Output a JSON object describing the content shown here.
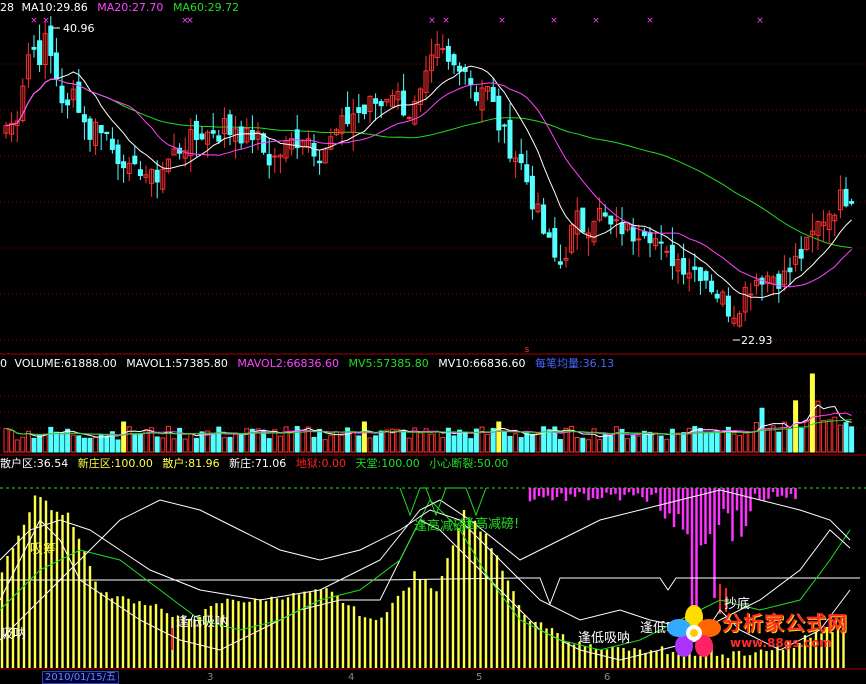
{
  "colors": {
    "bg": "#000000",
    "up": "#ff3030",
    "down": "#54ffff",
    "ma10": "#ffffff",
    "ma20": "#ff44ff",
    "ma60": "#22dd22",
    "yellow": "#ffff44",
    "grid": "#8b0000",
    "magenta": "#ff33ff"
  },
  "price_panel": {
    "left_cut": "28",
    "ma10_label": "MA10:29.86",
    "ma20_label": "MA20:27.70",
    "ma60_label": "MA60:29.72",
    "high_label": "40.96",
    "low_label": "22.93",
    "marker_glyph": "×",
    "s_glyph": "s"
  },
  "volume_panel": {
    "left_cut": "0",
    "volume": "VOLUME:61888.00",
    "mavol1": "MAVOL1:57385.80",
    "mavol2": "MAVOL2:66836.60",
    "mv5": "MV5:57385.80",
    "mv10": "MV10:66836.60",
    "avg_label": "每笔均量:36.13"
  },
  "indicator_panel": {
    "sanhu_label": "散户区:36.54",
    "xinzhuang_area": "新庄区:100.00",
    "sanhu": "散户:81.96",
    "xinzhuang": "新庄:71.06",
    "diyu": "地狱:0.00",
    "tiantang": "天堂:100.00",
    "duanlie": "小心断裂:50.00",
    "annotations": [
      "吸筹",
      "逢高减磅!",
      "逢高减磅!",
      "逢低吸呐",
      "逢低吸呐",
      "逢低吸呐",
      "抄底",
      "吸呐"
    ]
  },
  "x_axis": {
    "date_label": "2010/01/15/五",
    "month_ticks": [
      "3",
      "4",
      "5",
      "6"
    ]
  },
  "watermark": {
    "title": "分析家公式网",
    "url": "www.88gs.com"
  },
  "chart_data": {
    "type": "candlestick",
    "title": "",
    "price_range": [
      20.5,
      42.5
    ],
    "series": [
      {
        "name": "MA10",
        "last": 29.86
      },
      {
        "name": "MA20",
        "last": 27.7
      },
      {
        "name": "MA60",
        "last": 29.72
      }
    ],
    "annotated_high": 40.96,
    "annotated_low": 22.93,
    "close_path": [
      [
        0,
        34.5
      ],
      [
        6,
        35.5
      ],
      [
        12,
        35
      ],
      [
        18,
        37
      ],
      [
        24,
        39.5
      ],
      [
        30,
        40.5
      ],
      [
        36,
        39.5
      ],
      [
        42,
        40.8
      ],
      [
        48,
        39.8
      ],
      [
        54,
        38.5
      ],
      [
        60,
        37
      ],
      [
        66,
        36
      ],
      [
        72,
        37.5
      ],
      [
        78,
        36.5
      ],
      [
        84,
        35
      ],
      [
        90,
        34.5
      ],
      [
        96,
        35.5
      ],
      [
        102,
        35
      ],
      [
        108,
        34
      ],
      [
        114,
        33
      ],
      [
        120,
        33.5
      ],
      [
        126,
        32
      ],
      [
        132,
        31.8
      ],
      [
        138,
        32.5
      ],
      [
        144,
        32
      ],
      [
        150,
        31.5
      ],
      [
        156,
        32
      ],
      [
        162,
        32.5
      ],
      [
        168,
        33
      ],
      [
        174,
        33.5
      ],
      [
        180,
        33.8
      ],
      [
        186,
        34.2
      ],
      [
        192,
        34
      ],
      [
        198,
        34.8
      ],
      [
        204,
        34.5
      ],
      [
        210,
        35
      ],
      [
        216,
        34.6
      ],
      [
        222,
        35.2
      ],
      [
        228,
        34.8
      ],
      [
        234,
        35.2
      ],
      [
        240,
        34.6
      ],
      [
        246,
        34.2
      ],
      [
        252,
        34.8
      ],
      [
        258,
        33.8
      ],
      [
        264,
        33.2
      ],
      [
        270,
        32.8
      ],
      [
        276,
        33.2
      ],
      [
        282,
        33.6
      ],
      [
        288,
        34
      ],
      [
        294,
        34.2
      ],
      [
        300,
        34.6
      ],
      [
        306,
        34.4
      ],
      [
        312,
        33.8
      ],
      [
        318,
        33.4
      ],
      [
        324,
        33.8
      ],
      [
        330,
        34.2
      ],
      [
        336,
        34.8
      ],
      [
        342,
        35.2
      ],
      [
        348,
        35.8
      ],
      [
        354,
        36.2
      ],
      [
        360,
        35.8
      ],
      [
        366,
        36.4
      ],
      [
        372,
        36.8
      ],
      [
        378,
        36.4
      ],
      [
        384,
        37.2
      ],
      [
        390,
        37.6
      ],
      [
        396,
        37
      ],
      [
        402,
        36.4
      ],
      [
        408,
        36
      ],
      [
        414,
        36.4
      ],
      [
        420,
        37.2
      ],
      [
        426,
        38.4
      ],
      [
        432,
        39.6
      ],
      [
        438,
        40.2
      ],
      [
        444,
        39.4
      ],
      [
        450,
        38.8
      ],
      [
        456,
        39.6
      ],
      [
        462,
        39.2
      ],
      [
        468,
        38.2
      ],
      [
        474,
        37.2
      ],
      [
        480,
        37.8
      ],
      [
        486,
        37.4
      ],
      [
        492,
        36.2
      ],
      [
        498,
        35
      ],
      [
        504,
        34.2
      ],
      [
        510,
        33.6
      ],
      [
        516,
        33
      ],
      [
        522,
        32.2
      ],
      [
        528,
        30.8
      ],
      [
        534,
        29.6
      ],
      [
        540,
        28.4
      ],
      [
        546,
        27.4
      ],
      [
        552,
        26.4
      ],
      [
        558,
        26
      ],
      [
        564,
        27
      ],
      [
        570,
        28.2
      ],
      [
        576,
        29
      ],
      [
        582,
        28.4
      ],
      [
        588,
        29
      ],
      [
        594,
        29.6
      ],
      [
        600,
        29.2
      ],
      [
        606,
        28.6
      ],
      [
        612,
        28.2
      ],
      [
        618,
        28.6
      ],
      [
        624,
        28.2
      ],
      [
        630,
        28
      ],
      [
        636,
        28.4
      ],
      [
        642,
        28.6
      ],
      [
        648,
        28.2
      ],
      [
        654,
        27.6
      ],
      [
        660,
        26.8
      ],
      [
        666,
        26.2
      ],
      [
        672,
        26.6
      ],
      [
        678,
        26.2
      ],
      [
        684,
        26
      ],
      [
        690,
        25.6
      ],
      [
        696,
        25.8
      ],
      [
        702,
        25.4
      ],
      [
        708,
        24.8
      ],
      [
        714,
        24.2
      ],
      [
        720,
        23.8
      ],
      [
        726,
        23.2
      ],
      [
        732,
        23
      ],
      [
        738,
        23.6
      ],
      [
        744,
        24.4
      ],
      [
        750,
        24.8
      ],
      [
        756,
        25.2
      ],
      [
        762,
        25.4
      ],
      [
        768,
        25.2
      ],
      [
        774,
        25.4
      ],
      [
        780,
        25
      ],
      [
        786,
        25.4
      ],
      [
        792,
        26
      ],
      [
        798,
        26.6
      ],
      [
        804,
        27
      ],
      [
        810,
        27.8
      ],
      [
        816,
        28.6
      ],
      [
        822,
        29.2
      ],
      [
        828,
        29.6
      ],
      [
        834,
        30
      ],
      [
        840,
        30.4
      ],
      [
        846,
        30.6
      ],
      [
        852,
        30.8
      ]
    ],
    "volume": {
      "last": 61888.0,
      "mavol1": 57385.8,
      "mavol2": 66836.6,
      "range": [
        0,
        80000
      ]
    },
    "indicator": {
      "range": [
        0,
        100
      ],
      "sanhu_area": 36.54,
      "xinzhuang_area": 100.0,
      "sanhu": 81.96,
      "xinzhuang": 71.06,
      "diyu": 0.0,
      "tiantang": 100.0,
      "duanlie": 50.0
    }
  }
}
